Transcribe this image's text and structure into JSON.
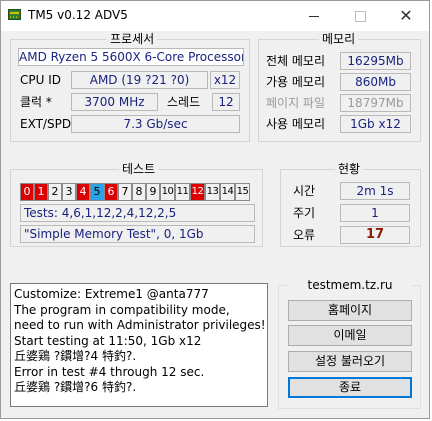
{
  "window": {
    "title": "TM5 v0.12 ADV5",
    "minimize": "–",
    "maximize": "□",
    "close": "✕"
  },
  "processor": {
    "group_label": "프로세서",
    "name": "AMD Ryzen 5 5600X 6-Core Processor",
    "cpu_id_label": "CPU ID",
    "cpu_id_value": "AMD  (19 ?21 ?0)",
    "cores": "x12",
    "clock_label": "클럭 *",
    "clock_value": "3700 MHz",
    "threads_label": "스레드",
    "threads_value": "12",
    "ext_spd_label": "EXT/SPD",
    "ext_spd_value": "7.3 Gb/sec"
  },
  "memory": {
    "group_label": "메모리",
    "total_label": "전체 메모리",
    "total_value": "16295Mb",
    "available_label": "가용 메모리",
    "available_value": "860Mb",
    "pagefile_label": "페이지 파일",
    "pagefile_value": "18797Mb",
    "used_label": "사용 메모리",
    "used_value": "1Gb x12"
  },
  "tests": {
    "group_label": "테스트",
    "cells": [
      {
        "label": "0",
        "state": "red"
      },
      {
        "label": "1",
        "state": "red"
      },
      {
        "label": "2",
        "state": "normal"
      },
      {
        "label": "3",
        "state": "normal"
      },
      {
        "label": "4",
        "state": "red"
      },
      {
        "label": "5",
        "state": "blue"
      },
      {
        "label": "6",
        "state": "red"
      },
      {
        "label": "7",
        "state": "normal"
      },
      {
        "label": "8",
        "state": "normal"
      },
      {
        "label": "9",
        "state": "normal"
      },
      {
        "label": "10",
        "state": "normal"
      },
      {
        "label": "11",
        "state": "normal"
      },
      {
        "label": "12",
        "state": "red"
      },
      {
        "label": "13",
        "state": "normal"
      },
      {
        "label": "14",
        "state": "normal"
      },
      {
        "label": "15",
        "state": "normal"
      }
    ],
    "sequence": "Tests: 4,6,1,12,2,4,12,2,5",
    "current": "\"Simple Memory Test\", 0, 1Gb"
  },
  "status": {
    "group_label": "현황",
    "time_label": "시간",
    "time_value": "2m 1s",
    "cycle_label": "주기",
    "cycle_value": "1",
    "errors_label": "오류",
    "errors_value": "17"
  },
  "log": {
    "lines": [
      "Customize: Extreme1 @anta777",
      "The program in compatibility mode,",
      "need to run with Administrator privileges!",
      "Start testing at 11:50, 1Gb x12",
      "丘婆鶏 ?鏆增?4 特釣?.",
      "Error in test #4 through 12 sec.",
      "丘婆鶏 ?鏆增?6 特釣?."
    ]
  },
  "actions": {
    "site": "testmem.tz.ru",
    "homepage": "홈페이지",
    "email": "이메일",
    "load_config": "설정 불러오기",
    "exit": "종료"
  }
}
